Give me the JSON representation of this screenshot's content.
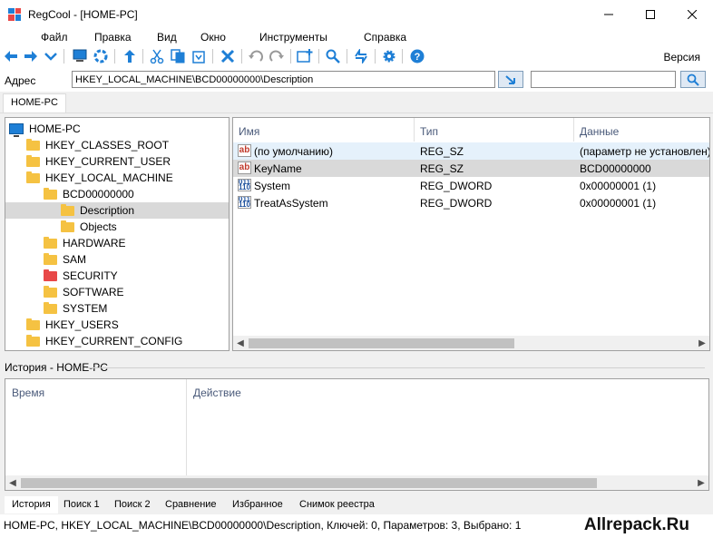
{
  "window": {
    "title": "RegCool - [HOME-PC]",
    "minimize": "—",
    "maximize": "☐",
    "close": "✕"
  },
  "menu": {
    "items": [
      "Файл",
      "Правка",
      "Вид",
      "Окно",
      "Инструменты",
      "Справка"
    ]
  },
  "toolbar": {
    "version_label": "Версия",
    "icons": [
      "back-arrow-icon",
      "forward-arrow-icon",
      "dropdown-icon",
      "computer-icon",
      "refresh-icon",
      "up-arrow-icon",
      "cut-icon",
      "copy-icon",
      "paste-icon",
      "delete-icon",
      "undo-icon",
      "redo-icon",
      "new-key-icon",
      "search-icon",
      "sync-icon",
      "settings-icon",
      "help-icon"
    ]
  },
  "address": {
    "label": "Адрес",
    "value": "HKEY_LOCAL_MACHINE\\BCD00000000\\Description",
    "search_value": ""
  },
  "top_tab": {
    "label": "HOME-PC"
  },
  "tree": {
    "items": [
      {
        "label": "HOME-PC",
        "depth": 0,
        "icon": "computer",
        "color": "#1e7fd6"
      },
      {
        "label": "HKEY_CLASSES_ROOT",
        "depth": 1,
        "icon": "folder",
        "color": "#f5c242"
      },
      {
        "label": "HKEY_CURRENT_USER",
        "depth": 1,
        "icon": "folder",
        "color": "#f5c242"
      },
      {
        "label": "HKEY_LOCAL_MACHINE",
        "depth": 1,
        "icon": "folder",
        "color": "#f5c242"
      },
      {
        "label": "BCD00000000",
        "depth": 2,
        "icon": "folder",
        "color": "#f5c242"
      },
      {
        "label": "Description",
        "depth": 3,
        "icon": "folder-open",
        "color": "#f5c242",
        "selected": true
      },
      {
        "label": "Objects",
        "depth": 3,
        "icon": "folder",
        "color": "#f5c242"
      },
      {
        "label": "HARDWARE",
        "depth": 2,
        "icon": "folder",
        "color": "#f5c242"
      },
      {
        "label": "SAM",
        "depth": 2,
        "icon": "folder",
        "color": "#f5c242"
      },
      {
        "label": "SECURITY",
        "depth": 2,
        "icon": "folder",
        "color": "#e84848"
      },
      {
        "label": "SOFTWARE",
        "depth": 2,
        "icon": "folder",
        "color": "#f5c242"
      },
      {
        "label": "SYSTEM",
        "depth": 2,
        "icon": "folder",
        "color": "#f5c242"
      },
      {
        "label": "HKEY_USERS",
        "depth": 1,
        "icon": "folder",
        "color": "#f5c242"
      },
      {
        "label": "HKEY_CURRENT_CONFIG",
        "depth": 1,
        "icon": "folder",
        "color": "#f5c242"
      }
    ]
  },
  "values": {
    "columns": [
      "Имя",
      "Тип",
      "Данные"
    ],
    "rows": [
      {
        "name": "(по умолчанию)",
        "type": "REG_SZ",
        "data": "(параметр не установлен)",
        "icon": "ab",
        "state": "hover"
      },
      {
        "name": "KeyName",
        "type": "REG_SZ",
        "data": "BCD00000000",
        "icon": "ab",
        "state": "selected"
      },
      {
        "name": "System",
        "type": "REG_DWORD",
        "data": "0x00000001 (1)",
        "icon": "dword",
        "state": ""
      },
      {
        "name": "TreatAsSystem",
        "type": "REG_DWORD",
        "data": "0x00000001 (1)",
        "icon": "dword",
        "state": ""
      }
    ]
  },
  "history": {
    "title": "История - HOME-PC",
    "columns": [
      "Время",
      "Действие"
    ]
  },
  "bottom_tabs": {
    "items": [
      "История",
      "Поиск 1",
      "Поиск 2",
      "Сравнение",
      "Избранное",
      "Снимок реестра"
    ],
    "active": 0
  },
  "status": {
    "text": "HOME-PC, HKEY_LOCAL_MACHINE\\BCD00000000\\Description, Ключей: 0, Параметров: 3, Выбрано: 1",
    "watermark": "Allrepack.Ru"
  },
  "colors": {
    "folder": "#f5c242",
    "security_folder": "#e84848",
    "accent_blue": "#1e7fd6"
  }
}
